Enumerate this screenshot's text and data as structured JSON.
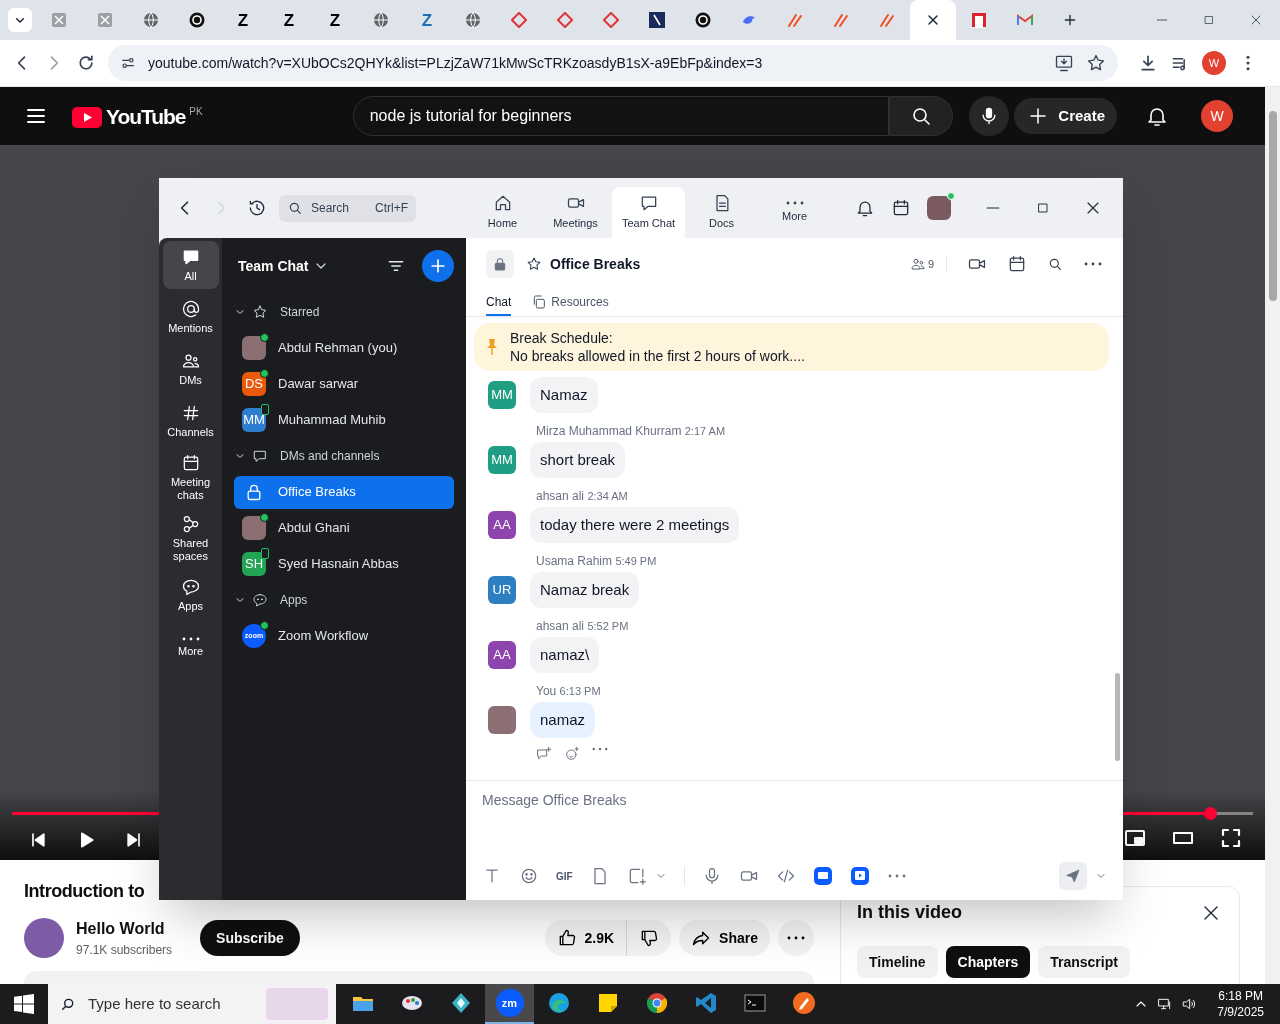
{
  "browser": {
    "tabs": [
      {
        "kind": "doc",
        "selected": false
      },
      {
        "kind": "doc",
        "selected": false
      },
      {
        "kind": "globe",
        "selected": false
      },
      {
        "kind": "openai",
        "selected": false
      },
      {
        "kind": "letter",
        "glyph": "Z",
        "color": "#000000",
        "selected": false
      },
      {
        "kind": "letter",
        "glyph": "Z",
        "color": "#000000",
        "selected": false
      },
      {
        "kind": "letter",
        "glyph": "Z",
        "color": "#000000",
        "selected": false
      },
      {
        "kind": "globe",
        "selected": false
      },
      {
        "kind": "letter",
        "glyph": "Z",
        "color": "#1f6fb2",
        "selected": false
      },
      {
        "kind": "globe",
        "selected": false
      },
      {
        "kind": "diamond",
        "selected": false
      },
      {
        "kind": "diamond",
        "selected": false
      },
      {
        "kind": "diamond",
        "selected": false
      },
      {
        "kind": "navy",
        "selected": false
      },
      {
        "kind": "openai",
        "selected": false
      },
      {
        "kind": "bird",
        "selected": false
      },
      {
        "kind": "stroke",
        "selected": false
      },
      {
        "kind": "stroke",
        "selected": false
      },
      {
        "kind": "stroke",
        "selected": false
      },
      {
        "kind": "blank",
        "selected": true
      },
      {
        "kind": "redsquare",
        "selected": false
      },
      {
        "kind": "gmail",
        "selected": false
      }
    ],
    "url": "youtube.com/watch?v=XUbOCs2QHYk&list=PLzjZaW71kMwScTRKzoasdyB1sX-a9EbFp&index=3",
    "profile": "W"
  },
  "youtube": {
    "logo": "YouTube",
    "region": "PK",
    "search": {
      "value": "node js tutorial for beginners"
    },
    "create": "Create",
    "avatar": "W",
    "player": {
      "level": 0.965
    },
    "video_title": "Introduction to",
    "channel": {
      "name": "Hello World",
      "subscribers": "97.1K subscribers"
    },
    "subscribe": "Subscribe",
    "likes": "2.9K",
    "share": "Share",
    "chapters_panel": {
      "title": "In this video",
      "tabs": [
        {
          "label": "Timeline",
          "selected": false
        },
        {
          "label": "Chapters",
          "selected": true
        },
        {
          "label": "Transcript",
          "selected": false
        }
      ]
    }
  },
  "zoom": {
    "search": {
      "placeholder": "Search",
      "shortcut": "Ctrl+F"
    },
    "nav": [
      {
        "label": "Home",
        "selected": false
      },
      {
        "label": "Meetings",
        "selected": false
      },
      {
        "label": "Team Chat",
        "selected": true
      },
      {
        "label": "Docs",
        "selected": false
      },
      {
        "label": "More",
        "selected": false
      }
    ],
    "rail": [
      {
        "label": "All",
        "selected": true
      },
      {
        "label": "Mentions",
        "selected": false
      },
      {
        "label": "DMs",
        "selected": false
      },
      {
        "label": "Channels",
        "selected": false
      },
      {
        "label": "Meeting chats",
        "selected": false
      },
      {
        "label": "Shared spaces",
        "selected": false
      },
      {
        "label": "Apps",
        "selected": false
      },
      {
        "label": "More",
        "selected": false
      }
    ],
    "list": {
      "title": "Team Chat",
      "sections": [
        {
          "label": "Starred",
          "expanded": true,
          "items": [
            {
              "name": "Abdul Rehman (you)",
              "avatar": {
                "kind": "photo"
              },
              "online": true,
              "mobile": false,
              "selected": false
            },
            {
              "name": "Dawar sarwar",
              "avatar": {
                "kind": "initials",
                "text": "DS",
                "color": "#e8590c"
              },
              "online": true,
              "mobile": false,
              "selected": false
            },
            {
              "name": "Muhammad Muhib",
              "avatar": {
                "kind": "initials",
                "text": "MM",
                "color": "#2e7dd1"
              },
              "online": false,
              "mobile": true,
              "selected": false
            }
          ]
        },
        {
          "label": "DMs and channels",
          "expanded": true,
          "items": [
            {
              "name": "Office Breaks",
              "avatar": {
                "kind": "lock"
              },
              "online": false,
              "mobile": false,
              "selected": true
            },
            {
              "name": "Abdul Ghani",
              "avatar": {
                "kind": "photo"
              },
              "online": true,
              "mobile": false,
              "selected": false
            },
            {
              "name": "Syed Hasnain Abbas",
              "avatar": {
                "kind": "initials",
                "text": "SH",
                "color": "#22a454"
              },
              "online": false,
              "mobile": true,
              "selected": false
            }
          ]
        },
        {
          "label": "Apps",
          "expanded": true,
          "items": [
            {
              "name": "Zoom Workflow",
              "avatar": {
                "kind": "app",
                "text": "zoom"
              },
              "online": true,
              "mobile": false,
              "selected": false
            }
          ]
        }
      ]
    },
    "channel": {
      "name": "Office Breaks",
      "members": "9",
      "tabs": [
        {
          "label": "Chat",
          "selected": true
        },
        {
          "label": "Resources",
          "selected": false
        }
      ],
      "pinned": {
        "title": "Break Schedule:",
        "text": "No breaks allowed in the first 2 hours of work...."
      },
      "messages": [
        {
          "avatar": {
            "kind": "initials",
            "text": "MM",
            "color": "#1f9e84"
          },
          "text": "Namaz",
          "own": false,
          "hovered": false
        },
        {
          "avatar": {
            "kind": "initials",
            "text": "MM",
            "color": "#1f9e84"
          },
          "sender": "Mirza Muhammad Khurram",
          "time": "2:17 AM",
          "text": "short break",
          "own": false,
          "hovered": false
        },
        {
          "avatar": {
            "kind": "initials",
            "text": "AA",
            "color": "#8e44ad"
          },
          "sender": "ahsan ali",
          "time": "2:34 AM",
          "text": "today there were 2 meetings",
          "own": false,
          "hovered": false
        },
        {
          "avatar": {
            "kind": "initials",
            "text": "UR",
            "color": "#2d7fc1"
          },
          "sender": "Usama Rahim",
          "time": "5:49 PM",
          "text": "Namaz break",
          "own": false,
          "hovered": false
        },
        {
          "avatar": {
            "kind": "initials",
            "text": "AA",
            "color": "#8e44ad"
          },
          "sender": "ahsan ali",
          "time": "5:52 PM",
          "text": "namaz\\",
          "own": false,
          "hovered": false
        },
        {
          "avatar": {
            "kind": "photo"
          },
          "sender": "You",
          "time": "6:13 PM",
          "text": "namaz",
          "own": true,
          "hovered": true
        }
      ],
      "composer": {
        "placeholder": "Message Office Breaks",
        "gif": "GIF"
      }
    }
  },
  "taskbar": {
    "search": {
      "placeholder": "Type here to search"
    },
    "apps": [
      {
        "selected": false
      },
      {
        "selected": false
      },
      {
        "selected": false
      },
      {
        "text": "zm",
        "selected": true
      },
      {
        "selected": false
      },
      {
        "selected": false
      },
      {
        "selected": false
      },
      {
        "selected": false
      },
      {
        "selected": false
      },
      {
        "selected": false
      }
    ],
    "time": "6:18 PM",
    "date": "7/9/2025"
  }
}
